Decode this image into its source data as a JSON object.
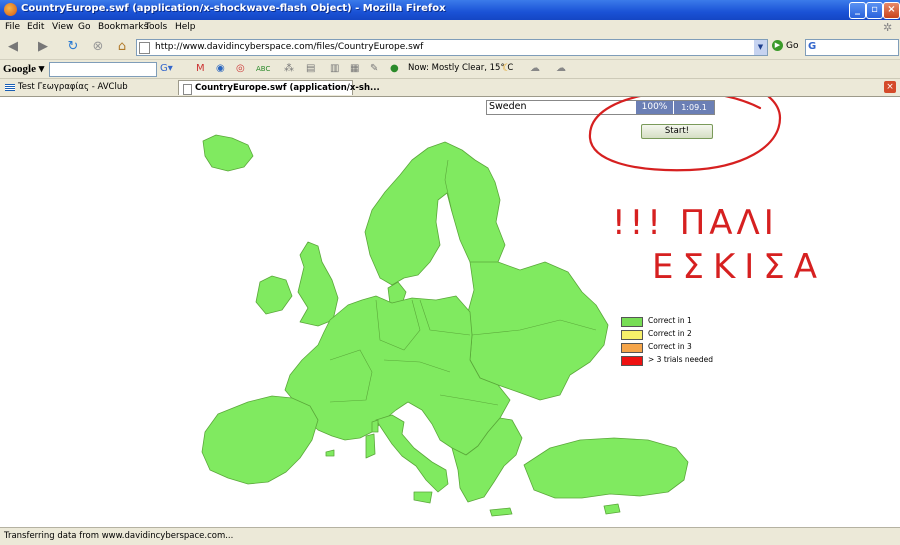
{
  "window": {
    "title": "CountryEurope.swf (application/x-shockwave-flash Object) - Mozilla Firefox"
  },
  "menu": [
    "File",
    "Edit",
    "View",
    "Go",
    "Bookmarks",
    "Tools",
    "Help"
  ],
  "nav": {
    "url": "http://www.davidincyberspace.com/files/CountryEurope.swf",
    "go_label": "Go"
  },
  "google_toolbar": {
    "logo": "Google",
    "weather": "Now: Mostly Clear, 15° C"
  },
  "tabs": [
    {
      "label": "Test Γεωγραφίας - AVClub",
      "active": false
    },
    {
      "label": "CountryEurope.swf (application/x-sh...",
      "active": true
    }
  ],
  "game": {
    "country_prompt": "Sweden",
    "percent": "100%",
    "timer": "1:09.1",
    "start_label": "Start!",
    "legend": [
      {
        "label": "Correct in 1",
        "color": "#77dd55"
      },
      {
        "label": "Correct in 2",
        "color": "#f7f06a"
      },
      {
        "label": "Correct in 3",
        "color": "#f5a54a"
      },
      {
        "label": "> 3 trials needed",
        "color": "#ee1111"
      }
    ],
    "map_color": "#80ea60",
    "map_border": "#5aa83a"
  },
  "annotation": {
    "color": "#d62020",
    "line1": "!!! ΠΑΛΙ",
    "line2": "ΕΣΚΙΣΑ"
  },
  "status": {
    "text": "Transferring data from www.davidincyberspace.com..."
  }
}
